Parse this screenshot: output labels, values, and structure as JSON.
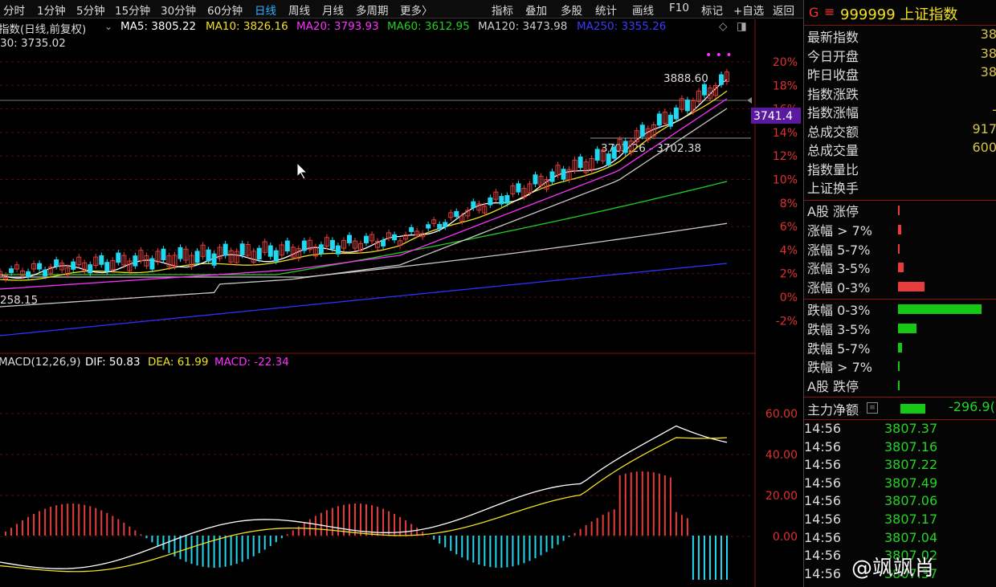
{
  "toolbar": {
    "periods": [
      "分时",
      "1分钟",
      "5分钟",
      "15分钟",
      "30分钟",
      "60分钟",
      "日线",
      "周线",
      "月线",
      "多周期",
      "更多〉"
    ],
    "active_period": "日线",
    "tools": [
      "指标",
      "叠加",
      "多股",
      "统计",
      "画线",
      "F10",
      "标记",
      "+自选",
      "返回"
    ]
  },
  "ma_info": {
    "title": "指数(日线,前复权)",
    "ma5": "MA5: 3805.22",
    "ma10": "MA10: 3826.16",
    "ma20": "MA20: 3793.93",
    "ma60": "MA60: 3612.95",
    "ma120": "MA120: 3473.98",
    "ma250": "MA250: 3355.26",
    "line2": "30: 3735.02",
    "colors": {
      "ma5": "#ffffff",
      "ma10": "#f0e020",
      "ma20": "#ff30ff",
      "ma60": "#20d020",
      "ma120": "#c8c8c8",
      "ma250": "#3030ff"
    }
  },
  "price_axis": {
    "labels": [
      "20%",
      "18%",
      "16%",
      "14%",
      "12%",
      "10%",
      "8%",
      "6%",
      "4%",
      "2%",
      "0%",
      "-2%"
    ],
    "current_price_tag": "3741.4"
  },
  "annotations": {
    "high": "3888.60",
    "support": "3702.26 - 3702.38",
    "low": "258.15"
  },
  "macd_info": {
    "title": "MACD(12,26,9)",
    "dif": "DIF: 50.83",
    "dea": "DEA: 61.99",
    "macd": "MACD: -22.34"
  },
  "macd_axis": {
    "labels": [
      "60.00",
      "40.00",
      "20.00",
      "0.00"
    ]
  },
  "quote": {
    "flag": "G",
    "menu_icon": "menu-icon",
    "code_name": "999999 上证指数",
    "rows": [
      {
        "label": "最新指数",
        "value": "38"
      },
      {
        "label": "今日开盘",
        "value": "38"
      },
      {
        "label": "昨日收盘",
        "value": "38"
      },
      {
        "label": "指数涨跌",
        "value": ""
      },
      {
        "label": "指数涨幅",
        "value": "-"
      },
      {
        "label": "总成交额",
        "value": "917"
      },
      {
        "label": "总成交量",
        "value": "600"
      },
      {
        "label": "指数量比",
        "value": ""
      },
      {
        "label": "上证换手",
        "value": ""
      }
    ]
  },
  "breadth": {
    "up": [
      {
        "label": "A股 涨停",
        "fraction": 0.01
      },
      {
        "label": "涨幅 > 7%",
        "fraction": 0.04
      },
      {
        "label": "涨幅 5-7%",
        "fraction": 0.015
      },
      {
        "label": "涨幅 3-5%",
        "fraction": 0.07
      },
      {
        "label": "涨幅 0-3%",
        "fraction": 0.32
      }
    ],
    "down": [
      {
        "label": "跌幅 0-3%",
        "fraction": 1.0
      },
      {
        "label": "跌幅 3-5%",
        "fraction": 0.22
      },
      {
        "label": "跌幅 5-7%",
        "fraction": 0.05
      },
      {
        "label": "跌幅 > 7%",
        "fraction": 0.015
      },
      {
        "label": "A股 跌停",
        "fraction": 0.01
      }
    ],
    "up_color": "#e83c3c",
    "down_color": "#14c814"
  },
  "main_flow": {
    "label": "主力净额",
    "value": "-296.9(",
    "bar_fraction": 0.3
  },
  "ticks": [
    {
      "time": "14:56",
      "price": "3807.37"
    },
    {
      "time": "14:56",
      "price": "3807.16"
    },
    {
      "time": "14:56",
      "price": "3807.22"
    },
    {
      "time": "14:56",
      "price": "3807.49"
    },
    {
      "time": "14:56",
      "price": "3807.06"
    },
    {
      "time": "14:56",
      "price": "3807.17"
    },
    {
      "time": "14:56",
      "price": "3807.04"
    },
    {
      "time": "14:56",
      "price": "3807.02"
    },
    {
      "time": "14:56",
      "price": "3807.37"
    }
  ],
  "watermark": "@飒飒肖"
}
